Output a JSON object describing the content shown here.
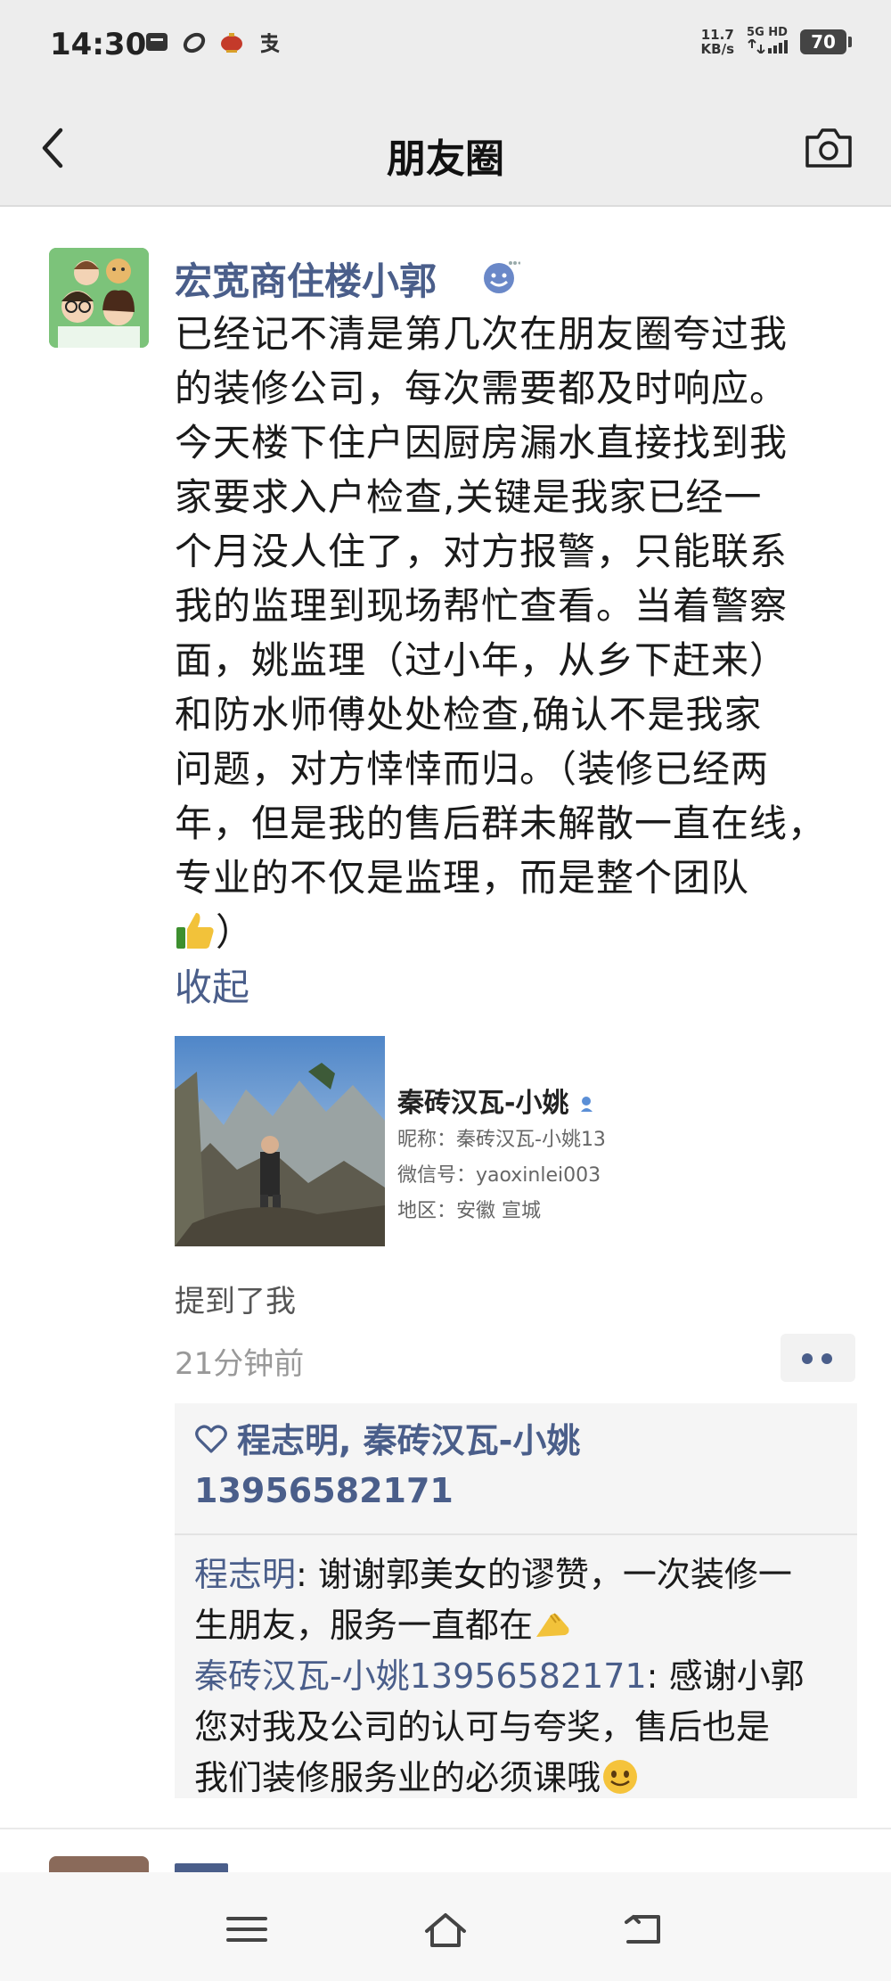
{
  "status_bar": {
    "time": "14:30",
    "net_speed_value": "11.7",
    "net_speed_unit": "KB/s",
    "signal_label": "5G HD",
    "battery": "70",
    "left_icons": [
      "message-icon",
      "link-icon",
      "lantern-icon",
      "alipay-icon"
    ]
  },
  "nav": {
    "title": "朋友圈",
    "back_icon": "chevron-left-icon",
    "camera_icon": "camera-icon"
  },
  "post": {
    "author": "宏宽商住楼小郭",
    "text_lines": [
      "已经记不清是第几次在朋友圈夸过我",
      "的装修公司，每次需要都及时响应。",
      "今天楼下住户因厨房漏水直接找到我",
      "家要求入户检查,关键是我家已经一",
      "个月没人住了，对方报警，只能联系",
      "我的监理到现场帮忙查看。当着警察",
      "面，姚监理（过小年，从乡下赶来）",
      "和防水师傅处处检查,确认不是我家",
      "问题，对方悻悻而归。（装修已经两",
      "年，但是我的售后群未解散一直在线，",
      "专业的不仅是监理，而是整个团队",
      "）"
    ],
    "collapse_label": "收起",
    "shared_card": {
      "name": "秦砖汉瓦-小姚",
      "nickname": "昵称：秦砖汉瓦-小姚13",
      "wechat_id": "微信号：yaoxinlei003",
      "region": "地区：安徽  宣城"
    },
    "mentioned": "提到了我",
    "time_ago": "21分钟前",
    "likes_line1": "程志明, 秦砖汉瓦-小姚",
    "likes_line2": "13956582171",
    "comments": [
      {
        "author": "程志明",
        "separator": ": ",
        "line1": "谢谢郭美女的谬赞，一次装修一",
        "line2": "生朋友，服务一直都在"
      },
      {
        "author": "秦砖汉瓦-小姚13956582171",
        "separator": ": ",
        "line1": "感谢小郭",
        "line2": "您对我及公司的认可与夸奖，售后也是",
        "line3": "我们装修服务业的必须课哦"
      }
    ]
  },
  "bottom_nav": {
    "icons": [
      "menu-icon",
      "home-icon",
      "back-icon"
    ]
  },
  "colors": {
    "link_blue": "#4a5e8a",
    "header_bg": "#ededed",
    "comment_bg": "#f5f5f5"
  }
}
